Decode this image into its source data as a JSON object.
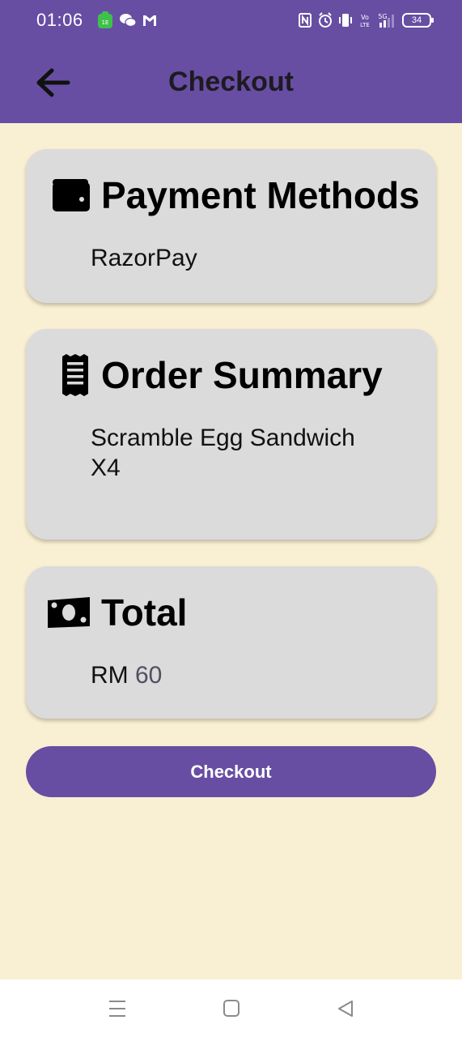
{
  "status_bar": {
    "time": "01:06",
    "battery": "34",
    "notification_icons": [
      "app-notification-icon",
      "wechat-icon",
      "gmail-icon"
    ],
    "system_icons": [
      "nfc-icon",
      "alarm-icon",
      "vibrate-icon",
      "volte-icon",
      "signal-5g-icon",
      "battery-icon"
    ]
  },
  "app_bar": {
    "title": "Checkout",
    "back_icon": "arrow-left-icon"
  },
  "cards": {
    "payment": {
      "title": "Payment Methods",
      "icon": "wallet-icon",
      "value": "RazorPay"
    },
    "order": {
      "title": "Order Summary",
      "icon": "receipt-icon",
      "items": [
        "Scramble Egg Sandwich",
        "X4"
      ]
    },
    "total": {
      "title": "Total",
      "icon": "money-icon",
      "currency": "RM",
      "amount": "60"
    }
  },
  "checkout_button": {
    "label": "Checkout"
  },
  "navigation_bar": {
    "icons": [
      "menu-icon",
      "home-icon",
      "back-icon"
    ]
  },
  "colors": {
    "primary": "#674ea3",
    "background": "#f9efd3",
    "card": "#dbdbdb"
  }
}
